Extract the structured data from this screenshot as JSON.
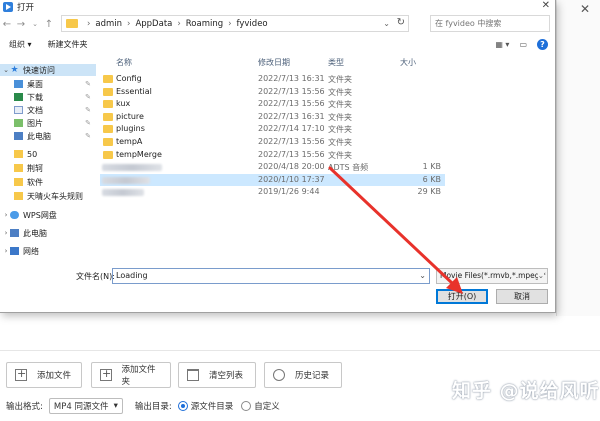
{
  "dialog": {
    "title": "打开",
    "close": "✕",
    "address": {
      "segments": [
        "admin",
        "AppData",
        "Roaming",
        "fyvideo"
      ],
      "separator": "›",
      "search_placeholder": "在 fyvideo 中搜索"
    },
    "toolbar": {
      "organize": "组织 ▾",
      "new_folder": "新建文件夹"
    },
    "nav": [
      {
        "label": "快速访问",
        "icon": "star-icon",
        "chev": "⌄"
      },
      {
        "label": "桌面",
        "icon": "desktop-icon",
        "pinned": true
      },
      {
        "label": "下载",
        "icon": "download-icon",
        "pinned": true
      },
      {
        "label": "文档",
        "icon": "document-icon",
        "pinned": true
      },
      {
        "label": "图片",
        "icon": "picture-icon",
        "pinned": true
      },
      {
        "label": "此电脑",
        "icon": "pc-icon",
        "pinned": true
      },
      {
        "label": "50",
        "icon": "folder-icon"
      },
      {
        "label": "荆轲",
        "icon": "folder-icon"
      },
      {
        "label": "软件",
        "icon": "folder-icon"
      },
      {
        "label": "天晴火车头规则",
        "icon": "folder-icon"
      },
      {
        "label": "WPS网盘",
        "icon": "cloud-icon",
        "chev": "›"
      },
      {
        "label": "此电脑",
        "icon": "pc-icon",
        "chev": "›"
      },
      {
        "label": "网络",
        "icon": "network-icon",
        "chev": "›"
      }
    ],
    "columns": {
      "name": "名称",
      "date": "修改日期",
      "type": "类型",
      "size": "大小"
    },
    "rows": [
      {
        "name": "Config",
        "date": "2022/7/13 16:31",
        "type": "文件夹",
        "size": ""
      },
      {
        "name": "Essential",
        "date": "2022/7/13 15:56",
        "type": "文件夹",
        "size": ""
      },
      {
        "name": "kux",
        "date": "2022/7/13 15:56",
        "type": "文件夹",
        "size": ""
      },
      {
        "name": "picture",
        "date": "2022/7/13 16:31",
        "type": "文件夹",
        "size": ""
      },
      {
        "name": "plugins",
        "date": "2022/7/14 17:10",
        "type": "文件夹",
        "size": ""
      },
      {
        "name": "tempA",
        "date": "2022/7/13 15:56",
        "type": "文件夹",
        "size": ""
      },
      {
        "name": "tempMerge",
        "date": "2022/7/13 15:56",
        "type": "文件夹",
        "size": ""
      },
      {
        "name": "",
        "date": "2020/4/18 20:00",
        "type": "ADTS 音频",
        "size": "1 KB"
      },
      {
        "name": "",
        "date": "2020/1/10 17:37",
        "type": "",
        "size": "6 KB"
      },
      {
        "name": "",
        "date": "2019/1/26 9:44",
        "type": "",
        "size": "29 KB"
      }
    ],
    "filename_label": "文件名(N):",
    "filename_value": "Loading",
    "filetype": "Movie Files(*.rmvb,*.mpeg,*",
    "open_button": "打开(O)",
    "cancel_button": "取消"
  },
  "app": {
    "buttons": [
      "添加文件",
      "添加文件夹",
      "清空列表",
      "历史记录"
    ],
    "output_format_label": "输出格式:",
    "output_format_value": "MP4 同源文件",
    "output_dir_label": "输出目录:",
    "output_dir_options": [
      "源文件目录",
      "自定义"
    ]
  },
  "watermark": "知乎 @说给风听",
  "accent_color": "#e8322b"
}
